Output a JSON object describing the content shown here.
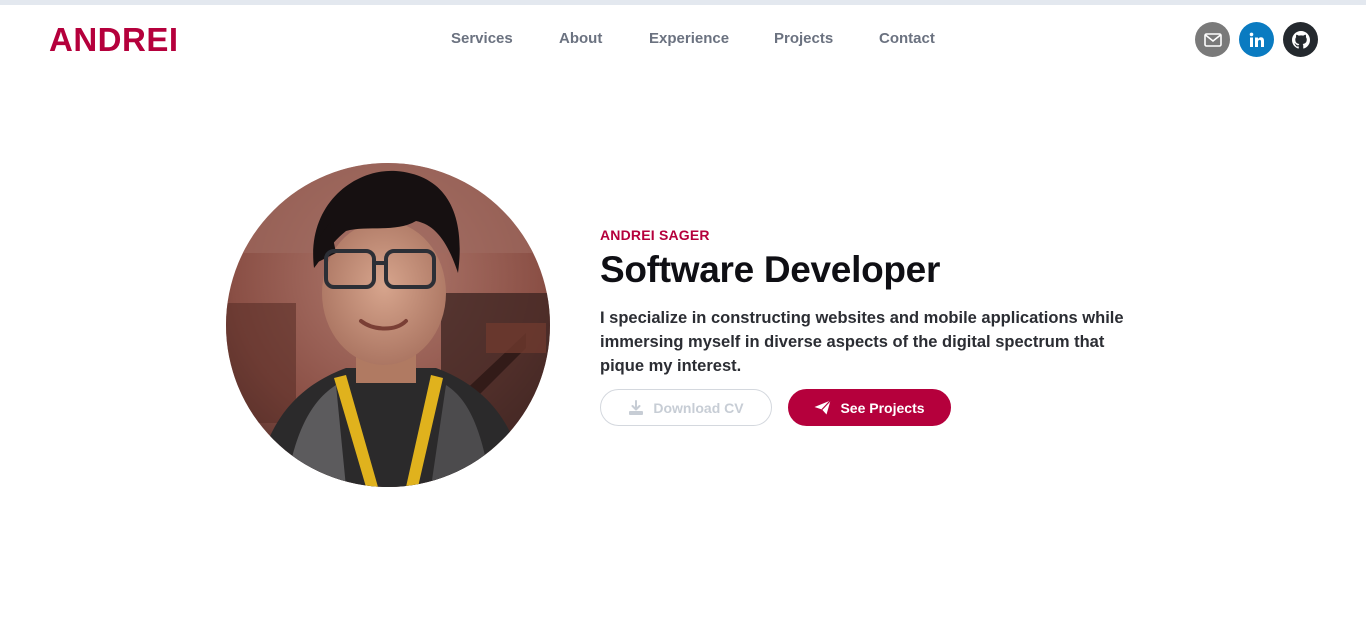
{
  "brand": {
    "logo_text": "ANDREI",
    "accent_color": "#b5003c"
  },
  "nav": {
    "items": [
      {
        "label": "Services"
      },
      {
        "label": "About"
      },
      {
        "label": "Experience"
      },
      {
        "label": "Projects"
      },
      {
        "label": "Contact"
      }
    ]
  },
  "socials": [
    {
      "icon": "mail-icon",
      "color": "#7a7a7a"
    },
    {
      "icon": "linkedin-icon",
      "color": "#0a7bc1"
    },
    {
      "icon": "github-icon",
      "color": "#24292e"
    }
  ],
  "hero": {
    "name": "ANDREI SAGER",
    "title": "Software Developer",
    "bio": "I specialize in constructing websites and mobile applications while immersing myself in diverse aspects of the digital spectrum that pique my interest.",
    "download_label": "Download CV",
    "projects_label": "See Projects"
  }
}
